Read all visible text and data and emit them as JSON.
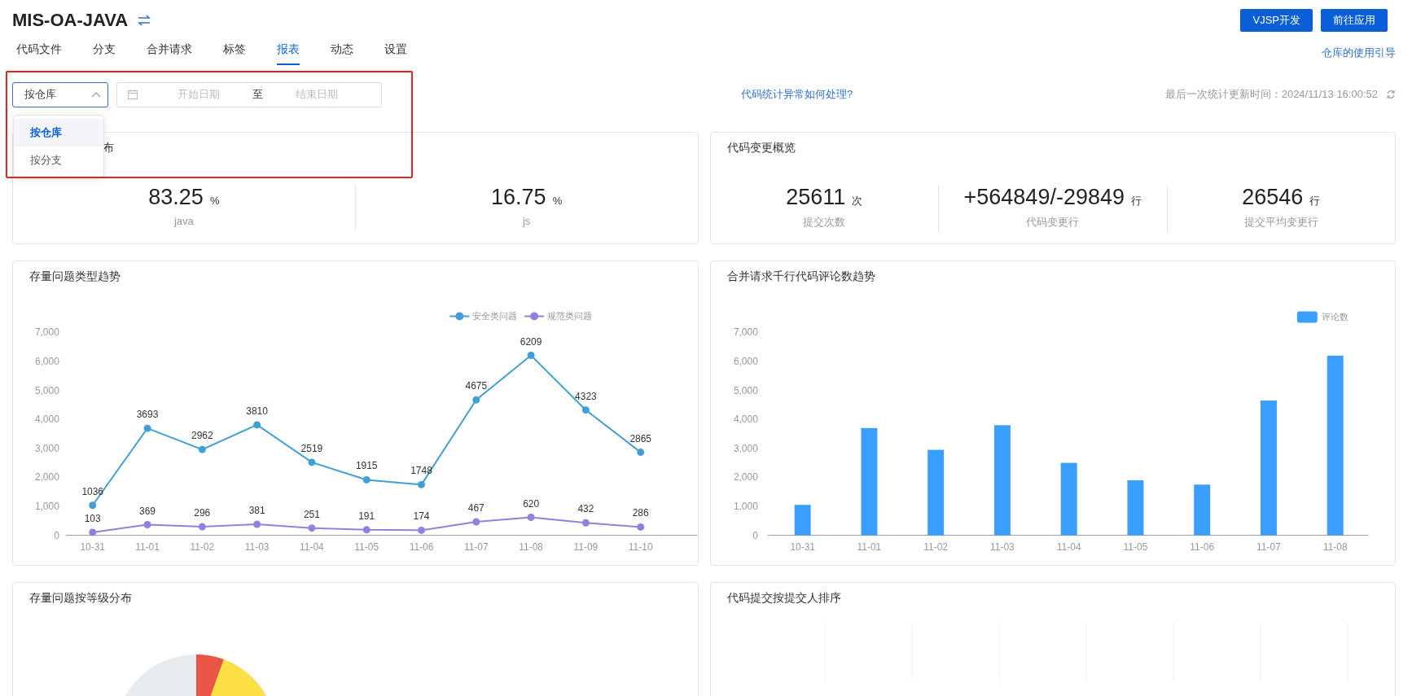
{
  "header": {
    "title": "MIS-OA-JAVA",
    "buttons": [
      "VJSP开发",
      "前往应用"
    ]
  },
  "tabs": [
    {
      "label": "代码文件",
      "selected": false
    },
    {
      "label": "分支",
      "selected": false
    },
    {
      "label": "合并请求",
      "selected": false
    },
    {
      "label": "标签",
      "selected": false
    },
    {
      "label": "报表",
      "selected": true
    },
    {
      "label": "动态",
      "selected": false
    },
    {
      "label": "设置",
      "selected": false
    }
  ],
  "guide_link": "仓库的使用引导",
  "filter": {
    "select_value": "按仓库",
    "expanded": true,
    "options": [
      {
        "label": "按仓库",
        "selected": true
      },
      {
        "label": "按分支",
        "selected": false
      }
    ],
    "start_placeholder": "开始日期",
    "separator": "至",
    "end_placeholder": "结束日期"
  },
  "help_link": "代码统计异常如何处理?",
  "last_update": "最后一次统计更新时间：2024/11/13 16:00:52",
  "language_card": {
    "title": "布",
    "stats": [
      {
        "value": "83.25",
        "unit": "%",
        "label": "java"
      },
      {
        "value": "16.75",
        "unit": "%",
        "label": "js"
      }
    ]
  },
  "change_card": {
    "title": "代码变更概览",
    "stats": [
      {
        "value": "25611",
        "unit": "次",
        "label": "提交次数"
      },
      {
        "value": "+564849/-29849",
        "unit": "行",
        "label": "代码变更行"
      },
      {
        "value": "26546",
        "unit": "行",
        "label": "提交平均变更行"
      }
    ]
  },
  "issue_trend": {
    "title": "存量问题类型趋势",
    "chart_data": {
      "type": "line",
      "legend": "top-right",
      "categories": [
        "10-31",
        "11-01",
        "11-02",
        "11-03",
        "11-04",
        "11-05",
        "11-06",
        "11-07",
        "11-08",
        "11-09",
        "11-10"
      ],
      "ylim": [
        0,
        7000
      ],
      "yticks": [
        {
          "value": 0,
          "label": "0"
        },
        {
          "value": 1000,
          "label": "1,000"
        },
        {
          "value": 2000,
          "label": "2,000"
        },
        {
          "value": 3000,
          "label": "3,000"
        },
        {
          "value": 4000,
          "label": "4,000"
        },
        {
          "value": 5000,
          "label": "5,000"
        },
        {
          "value": 6000,
          "label": "6,000"
        },
        {
          "value": 7000,
          "label": "7,000"
        }
      ],
      "data_labels": true,
      "series": [
        {
          "name": "安全类问题",
          "color": "#409fd6",
          "marker": "circle",
          "values": [
            1036,
            3693,
            2962,
            3810,
            2519,
            1915,
            1748,
            4675,
            6209,
            4323,
            2865
          ]
        },
        {
          "name": "规范类问题",
          "color": "#9280e0",
          "marker": "circle",
          "values": [
            103,
            369,
            296,
            381,
            251,
            191,
            174,
            467,
            620,
            432,
            286
          ]
        }
      ]
    }
  },
  "comment_trend": {
    "title": "合并请求千行代码评论数趋势",
    "chart_data": {
      "type": "bar",
      "legend": "top-right",
      "categories": [
        "10-31",
        "11-01",
        "11-02",
        "11-03",
        "11-04",
        "11-05",
        "11-06",
        "11-07",
        "11-08"
      ],
      "ylim": [
        0,
        7000
      ],
      "yticks": [
        {
          "value": 0,
          "label": "0"
        },
        {
          "value": 1000,
          "label": "1,000"
        },
        {
          "value": 2000,
          "label": "2,000"
        },
        {
          "value": 3000,
          "label": "3,000"
        },
        {
          "value": 4000,
          "label": "4,000"
        },
        {
          "value": 5000,
          "label": "5,000"
        },
        {
          "value": 6000,
          "label": "6,000"
        },
        {
          "value": 7000,
          "label": "7,000"
        }
      ],
      "series": [
        {
          "name": "评论数",
          "color": "#3a9eff",
          "values": [
            1050,
            3700,
            2950,
            3800,
            2500,
            1900,
            1750,
            4650,
            6200
          ]
        }
      ]
    }
  },
  "level_card": {
    "title": "存量问题按等级分布"
  },
  "committer_card": {
    "title": "代码提交按提交人排序"
  }
}
